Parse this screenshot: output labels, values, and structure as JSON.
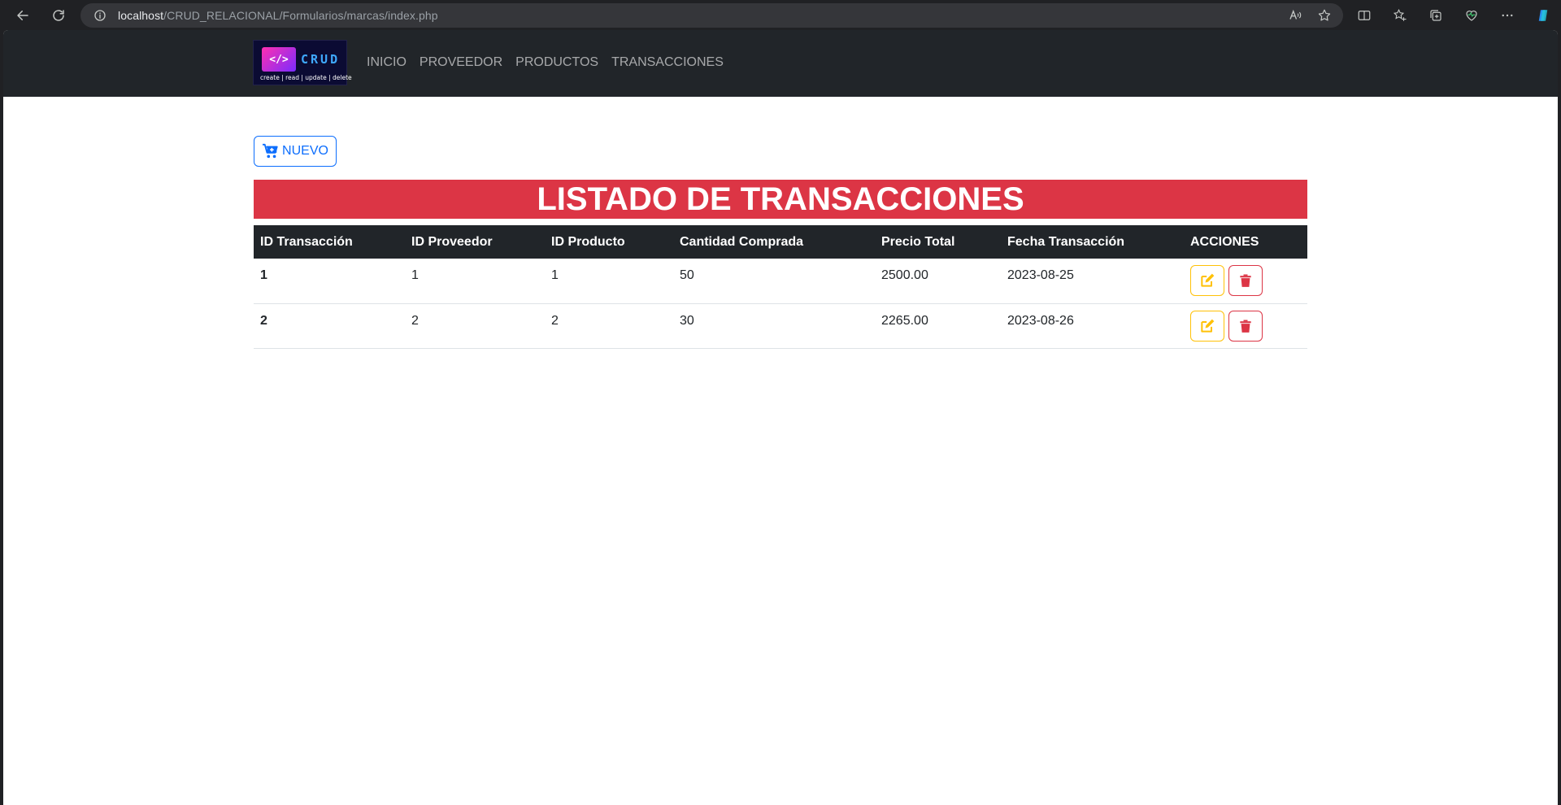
{
  "browser": {
    "url_host": "localhost",
    "url_path": "/CRUD_RELACIONAL/Formularios/marcas/index.php"
  },
  "navbar": {
    "logo": {
      "code_glyph": "</>",
      "brand": "CRUD",
      "tagline": "create | read | update | delete"
    },
    "links": [
      "INICIO",
      "PROVEEDOR",
      "PRODUCTOS",
      "TRANSACCIONES"
    ]
  },
  "main": {
    "new_button_label": "NUEVO",
    "title": "LISTADO DE TRANSACCIONES",
    "table": {
      "headers": [
        "ID Transacción",
        "ID Proveedor",
        "ID Producto",
        "Cantidad Comprada",
        "Precio Total",
        "Fecha Transacción",
        "ACCIONES"
      ],
      "rows": [
        [
          "1",
          "1",
          "1",
          "50",
          "2500.00",
          "2023-08-25"
        ],
        [
          "2",
          "2",
          "2",
          "30",
          "2265.00",
          "2023-08-26"
        ]
      ]
    }
  },
  "colors": {
    "navbar_bg": "#212529",
    "primary": "#0d6efd",
    "danger": "#dc3545",
    "warning": "#ffc107"
  }
}
